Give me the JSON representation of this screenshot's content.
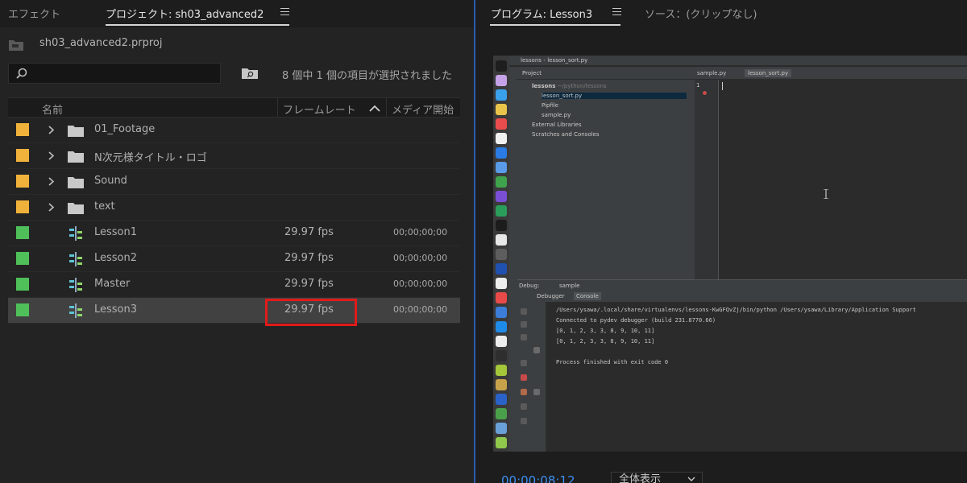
{
  "project_panel": {
    "tabs": [
      {
        "label": "エフェクト"
      },
      {
        "label": "プロジェクト: sh03_advanced2"
      }
    ],
    "file_name": "sh03_advanced2.prproj",
    "search": {
      "value": "",
      "placeholder": ""
    },
    "selection_status": "8 個中 1 個の項目が選択されました",
    "columns": [
      "名前",
      "フレームレート",
      "メディア開始"
    ],
    "rows": [
      {
        "type": "bin",
        "label_color": "#f0b23b",
        "name": "01_Footage",
        "fps": "",
        "start": ""
      },
      {
        "type": "bin",
        "label_color": "#f0b23b",
        "name": "N次元様タイトル・ロゴ",
        "fps": "",
        "start": ""
      },
      {
        "type": "bin",
        "label_color": "#f0b23b",
        "name": "Sound",
        "fps": "",
        "start": ""
      },
      {
        "type": "bin",
        "label_color": "#f0b23b",
        "name": "text",
        "fps": "",
        "start": ""
      },
      {
        "type": "sequence",
        "label_color": "#4fbf5a",
        "name": "Lesson1",
        "fps": "29.97 fps",
        "start": "00;00;00;00"
      },
      {
        "type": "sequence",
        "label_color": "#4fbf5a",
        "name": "Lesson2",
        "fps": "29.97 fps",
        "start": "00;00;00;00"
      },
      {
        "type": "sequence",
        "label_color": "#4fbf5a",
        "name": "Master",
        "fps": "29.97 fps",
        "start": "00;00;00;00"
      },
      {
        "type": "sequence",
        "label_color": "#4fbf5a",
        "name": "Lesson3",
        "fps": "29.97 fps",
        "start": "00;00;00;00",
        "selected": true
      }
    ]
  },
  "program_monitor": {
    "tabs": [
      {
        "label": "プログラム: Lesson3"
      },
      {
        "label": "ソース：(クリップなし)"
      }
    ],
    "timecode": "00;00;08;12",
    "zoom_label": "全体表示",
    "screen": {
      "window_title": "lessons",
      "window_file": "lesson_sort.py",
      "project_label": "Project",
      "editor_tabs": [
        "sample.py",
        "lesson_sort.py"
      ],
      "tree": {
        "root": "lessons",
        "root_hint": "~/python/lessons",
        "items": [
          "lesson_sort.py",
          "Pipfile",
          "sample.py",
          "External Libraries",
          "Scratches and Consoles"
        ]
      },
      "line_number": "1",
      "debug_label": "Debug:",
      "debug_config": "sample",
      "debug_tabs": [
        "Debugger",
        "Console"
      ],
      "console_lines": [
        "/Users/ysawa/.local/share/virtualenvs/lessons-KwGFQvZj/bin/python /Users/ysawa/Library/Application Support",
        "Connected to pydev debugger (build 231.8770.66)",
        "[0, 1, 2, 3, 3, 8, 9, 10, 11]",
        "[0, 1, 2, 3, 3, 8, 9, 10, 11]",
        "",
        "Process finished with exit code 0"
      ]
    }
  }
}
